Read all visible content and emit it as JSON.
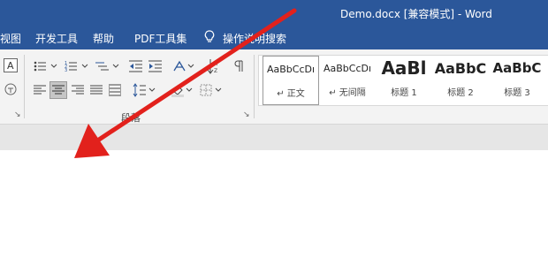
{
  "window": {
    "title": "Demo.docx [兼容模式]  -  Word"
  },
  "menu": {
    "view": "视图",
    "developer": "开发工具",
    "help": "帮助",
    "pdf_tools": "PDF工具集",
    "tell_me": "操作说明搜索"
  },
  "ribbon": {
    "paragraph_group_label": "段落",
    "styles": [
      {
        "preview": "AaBbCcDı",
        "name": "↵ 正文"
      },
      {
        "preview": "AaBbCcDı",
        "name": "↵ 无间隔"
      },
      {
        "preview": "AaBl",
        "name": "标题 1"
      },
      {
        "preview": "AaBbC",
        "name": "标题 2"
      },
      {
        "preview": "AaBbC",
        "name": "标题 3"
      }
    ]
  },
  "colors": {
    "title_bar": "#2b579a",
    "arrow": "#e2211c"
  },
  "icons": [
    "font-size-a-icon",
    "phonetic-guide-icon",
    "bullets-icon",
    "numbering-icon",
    "multilevel-list-icon",
    "decrease-indent-icon",
    "increase-indent-icon",
    "chinese-layout-icon",
    "sort-icon",
    "show-marks-icon",
    "align-left-icon",
    "align-center-icon",
    "align-right-icon",
    "justify-icon",
    "distributed-icon",
    "line-spacing-icon",
    "shading-icon",
    "borders-icon",
    "lightbulb-icon",
    "dialog-launcher-icon"
  ]
}
